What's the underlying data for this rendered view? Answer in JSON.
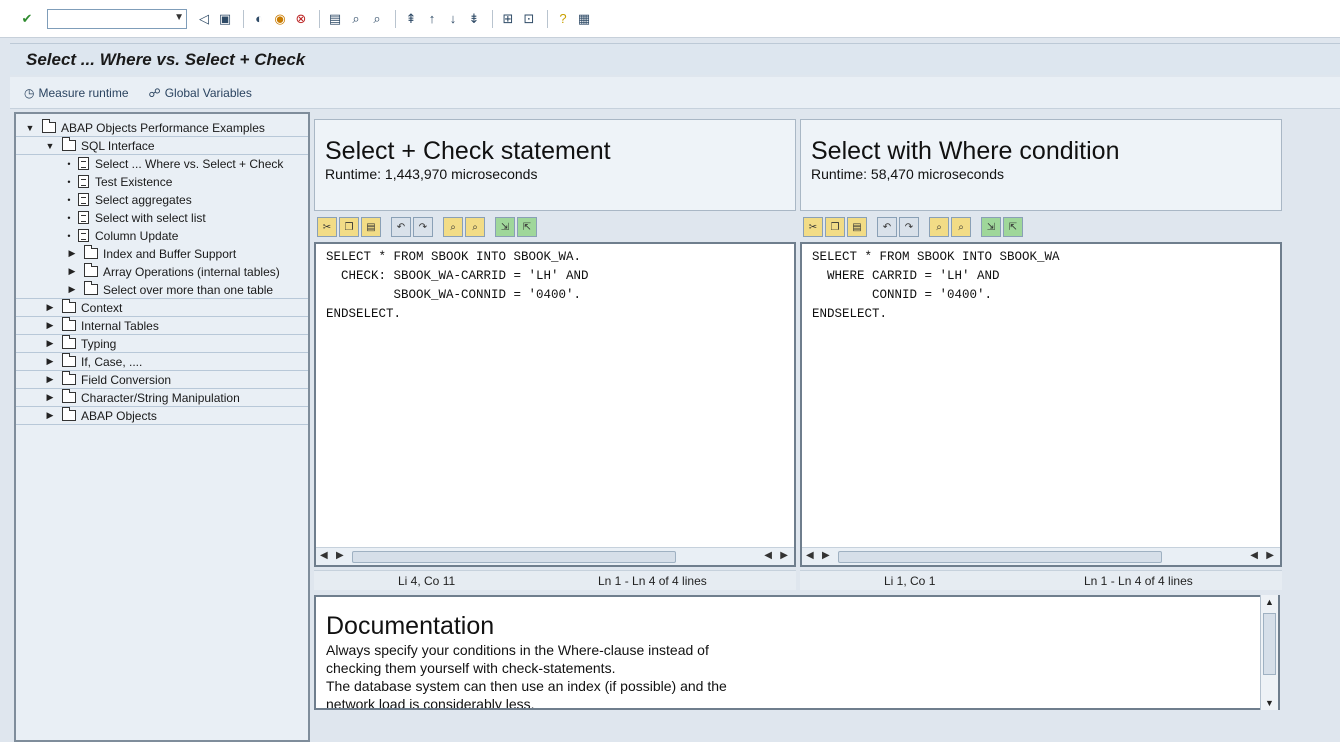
{
  "title": "Select ... Where vs. Select + Check",
  "app_toolbar": {
    "measure_runtime": "Measure runtime",
    "global_variables": "Global Variables"
  },
  "tree": {
    "root": "ABAP Objects Performance Examples",
    "sql_interface": "SQL Interface",
    "sql_items": [
      "Select ... Where vs. Select + Check",
      "Test Existence",
      "Select aggregates",
      "Select with select list",
      "Column Update",
      "Index and Buffer Support",
      "Array Operations (internal tables)",
      "Select over more than one table"
    ],
    "others": [
      "Context",
      "Internal Tables",
      "Typing",
      "If, Case, ....",
      "Field Conversion",
      "Character/String Manipulation",
      "ABAP Objects"
    ]
  },
  "left_pane": {
    "heading": "Select + Check statement",
    "runtime": "Runtime: 1,443,970 microseconds",
    "code": "SELECT * FROM SBOOK INTO SBOOK_WA.\n  CHECK: SBOOK_WA-CARRID = 'LH' AND\n         SBOOK_WA-CONNID = '0400'.\nENDSELECT.",
    "status_pos": "Li 4, Co 11",
    "status_lines": "Ln 1 - Ln 4 of 4 lines"
  },
  "right_pane": {
    "heading": "Select with Where condition",
    "runtime": "Runtime: 58,470 microseconds",
    "code": "SELECT * FROM SBOOK INTO SBOOK_WA\n  WHERE CARRID = 'LH' AND\n        CONNID = '0400'.\nENDSELECT.",
    "status_pos": "Li 1, Co 1",
    "status_lines": "Ln 1 - Ln 4 of 4 lines"
  },
  "documentation": {
    "title": "Documentation",
    "lines": [
      "Always specify your conditions in the Where-clause instead of",
      "checking them yourself with check-statements.",
      "The database system can then use an index (if possible) and the",
      "network load is considerably less."
    ]
  }
}
